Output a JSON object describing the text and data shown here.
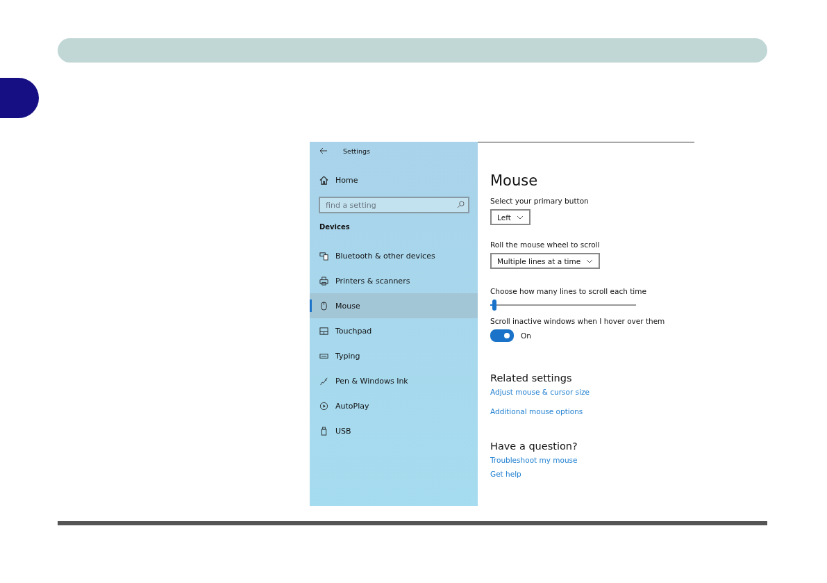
{
  "window": {
    "title": "Settings"
  },
  "sidebar": {
    "home": "Home",
    "search": {
      "placeholder": "find a setting"
    },
    "section": "Devices",
    "items": [
      {
        "label": "Bluetooth & other devices",
        "selected": false
      },
      {
        "label": "Printers & scanners",
        "selected": false
      },
      {
        "label": "Mouse",
        "selected": true
      },
      {
        "label": "Touchpad",
        "selected": false
      },
      {
        "label": "Typing",
        "selected": false
      },
      {
        "label": "Pen & Windows Ink",
        "selected": false
      },
      {
        "label": "AutoPlay",
        "selected": false
      },
      {
        "label": "USB",
        "selected": false
      }
    ]
  },
  "content": {
    "title": "Mouse",
    "primary_button": {
      "label": "Select your primary button",
      "value": "Left"
    },
    "wheel": {
      "label": "Roll the mouse wheel to scroll",
      "value": "Multiple lines at a time"
    },
    "lines": {
      "label": "Choose how many lines to scroll each time",
      "level": 0.03
    },
    "inactive_scroll": {
      "label": "Scroll inactive windows when I hover over them",
      "on": true,
      "state": "On"
    },
    "related": {
      "title": "Related settings",
      "links": [
        "Adjust mouse & cursor size",
        "Additional mouse options"
      ]
    },
    "question": {
      "title": "Have a question?",
      "links": [
        "Troubleshoot my mouse",
        "Get help"
      ]
    }
  }
}
